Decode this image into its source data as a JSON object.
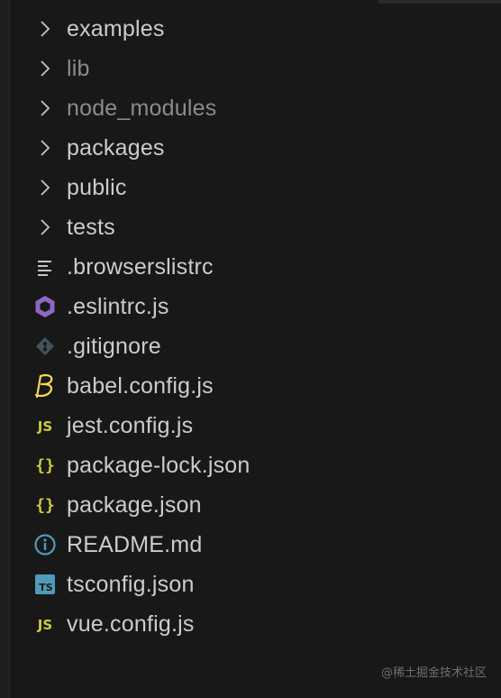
{
  "explorer": {
    "items": [
      {
        "label": "examples",
        "kind": "folder",
        "icon": "chevron-right-icon",
        "dimmed": false
      },
      {
        "label": "lib",
        "kind": "folder",
        "icon": "chevron-right-icon",
        "dimmed": true
      },
      {
        "label": "node_modules",
        "kind": "folder",
        "icon": "chevron-right-icon",
        "dimmed": true
      },
      {
        "label": "packages",
        "kind": "folder",
        "icon": "chevron-right-icon",
        "dimmed": false
      },
      {
        "label": "public",
        "kind": "folder",
        "icon": "chevron-right-icon",
        "dimmed": false
      },
      {
        "label": "tests",
        "kind": "folder",
        "icon": "chevron-right-icon",
        "dimmed": false
      },
      {
        "label": ".browserslistrc",
        "kind": "file",
        "icon": "lines-file-icon",
        "dimmed": false
      },
      {
        "label": ".eslintrc.js",
        "kind": "file",
        "icon": "eslint-icon",
        "dimmed": false
      },
      {
        "label": ".gitignore",
        "kind": "file",
        "icon": "git-icon",
        "dimmed": false
      },
      {
        "label": "babel.config.js",
        "kind": "file",
        "icon": "babel-icon",
        "dimmed": false
      },
      {
        "label": "jest.config.js",
        "kind": "file",
        "icon": "js-icon",
        "dimmed": false
      },
      {
        "label": "package-lock.json",
        "kind": "file",
        "icon": "json-icon",
        "dimmed": false
      },
      {
        "label": "package.json",
        "kind": "file",
        "icon": "json-icon",
        "dimmed": false
      },
      {
        "label": "README.md",
        "kind": "file",
        "icon": "info-icon",
        "dimmed": false
      },
      {
        "label": "tsconfig.json",
        "kind": "file",
        "icon": "ts-icon",
        "dimmed": false
      },
      {
        "label": "vue.config.js",
        "kind": "file",
        "icon": "js-icon",
        "dimmed": false
      }
    ]
  },
  "watermark": "@稀土掘金技术社区",
  "colors": {
    "background": "#181818",
    "text": "#cccccc",
    "dimmed_text": "#8b8b8b",
    "js_yellow": "#cbcb41",
    "eslint_purple": "#8e67c4",
    "ts_blue": "#519aba",
    "info_blue": "#519aba",
    "git_gray": "#41535b"
  }
}
